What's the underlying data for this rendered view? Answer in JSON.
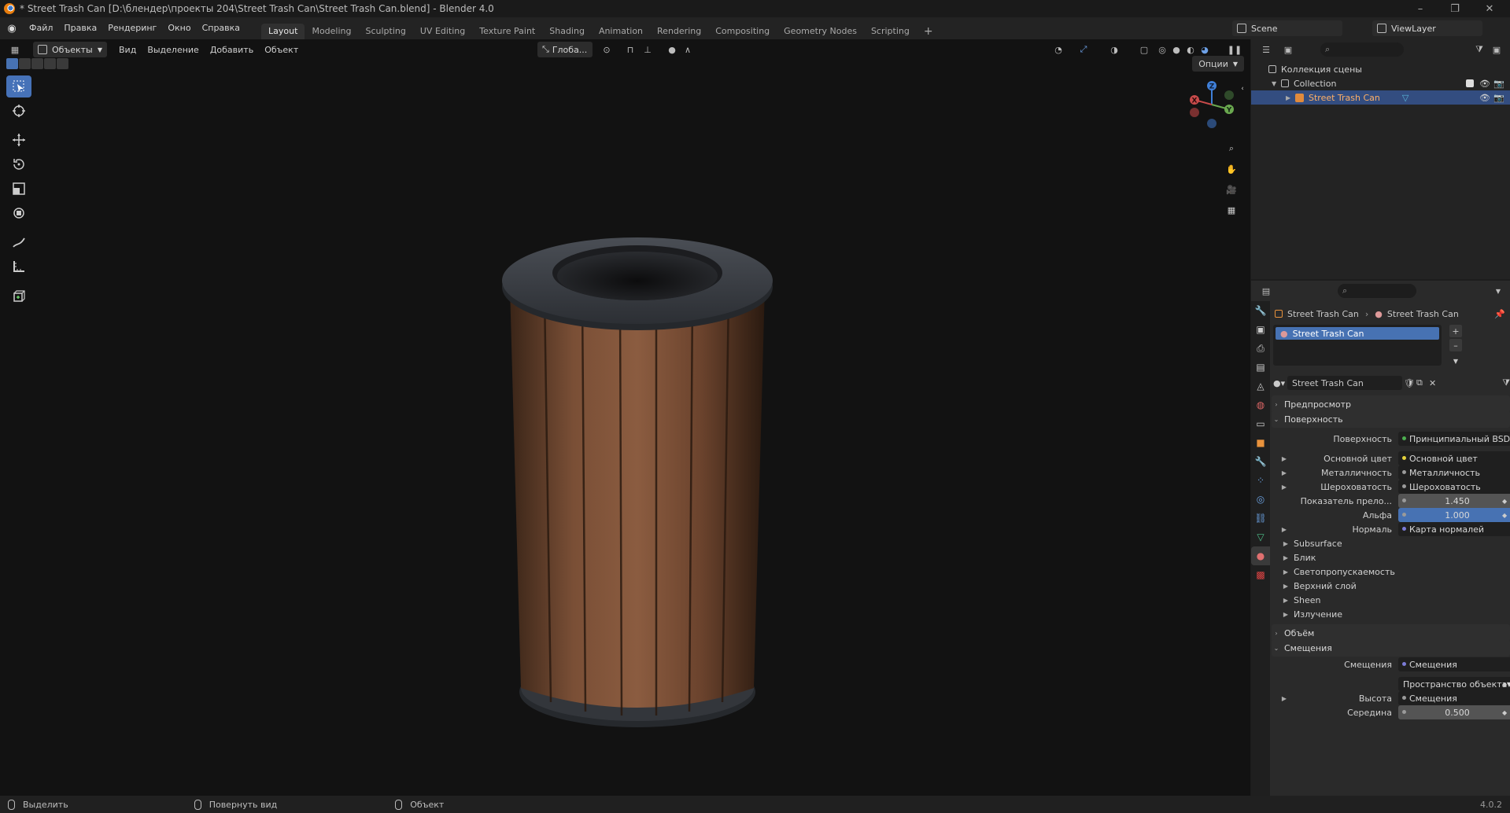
{
  "window": {
    "title": "* Street Trash Can [D:\\блендер\\проекты 204\\Street Trash Can\\Street Trash Can.blend] - Blender 4.0",
    "minimize": "–",
    "maximize": "❐",
    "close": "✕"
  },
  "menu": {
    "items": [
      "Файл",
      "Правка",
      "Рендеринг",
      "Окно",
      "Справка"
    ]
  },
  "workspaces": {
    "tabs": [
      "Layout",
      "Modeling",
      "Sculpting",
      "UV Editing",
      "Texture Paint",
      "Shading",
      "Animation",
      "Rendering",
      "Compositing",
      "Geometry Nodes",
      "Scripting"
    ],
    "active": "Layout",
    "add": "+"
  },
  "scene": {
    "name": "Scene",
    "view_layer": "ViewLayer"
  },
  "viewport": {
    "mode": "Объекты",
    "menus": [
      "Вид",
      "Выделение",
      "Добавить",
      "Объект"
    ],
    "orientation": "Глоба...",
    "options": "Опции",
    "gizmo": {
      "x": "X",
      "y": "Y",
      "z": "Z"
    },
    "background": "#121212",
    "selected_object": "Street Trash Can"
  },
  "outliner": {
    "root": "Коллекция сцены",
    "collection": "Collection",
    "object": "Street Trash Can"
  },
  "properties": {
    "breadcrumb": {
      "object": "Street Trash Can",
      "material": "Street Trash Can"
    },
    "material_slot": "Street Trash Can",
    "material_name": "Street Trash Can",
    "sections": {
      "preview": "Предпросмотр",
      "surface": "Поверхность",
      "volume": "Объём",
      "displacement": "Смещения"
    },
    "surface": {
      "shader_label": "Поверхность",
      "shader_value": "Принципиальный BSDF",
      "base_color_label": "Основной цвет",
      "base_color_value": "Основной цвет",
      "metallic_label": "Металличность",
      "metallic_value": "Металличность",
      "roughness_label": "Шероховатость",
      "roughness_value": "Шероховатость",
      "ior_label": "Показатель прело...",
      "ior_value": "1.450",
      "alpha_label": "Альфа",
      "alpha_value": "1.000",
      "normal_label": "Нормаль",
      "normal_value": "Карта нормалей",
      "subpanels": [
        "Subsurface",
        "Блик",
        "Светопропускаемость",
        "Верхний слой",
        "Sheen",
        "Излучение"
      ]
    },
    "displacement": {
      "disp_label": "Смещения",
      "disp_value": "Смещения",
      "space_value": "Пространство объекта",
      "height_label": "Высота",
      "height_value": "Смещения",
      "midlevel_label": "Середина",
      "midlevel_value": "0.500"
    }
  },
  "status": {
    "select": "Выделить",
    "rotate_view": "Повернуть вид",
    "object": "Объект",
    "version": "4.0.2"
  },
  "colors": {
    "accent": "#4772b3",
    "selection": "#334d80",
    "wood": "#7a4e34",
    "metal_rim": "#3b4047"
  }
}
